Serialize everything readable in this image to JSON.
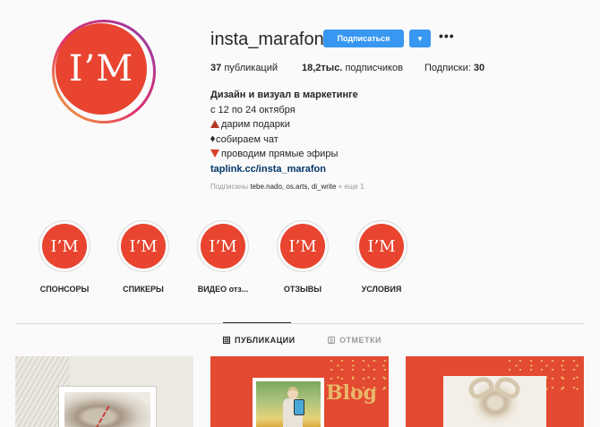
{
  "profile": {
    "avatar_text": "I’M",
    "username": "insta_marafon",
    "follow_label": "Подписаться",
    "dropdown_icon": "▼",
    "more_icon": "•••",
    "stats": {
      "posts_count": "37",
      "posts_label": "публикаций",
      "followers_count": "18,2тыс.",
      "followers_label": "подписчиков",
      "following_label": "Подписки:",
      "following_count": "30"
    },
    "bio": {
      "title": "Дизайн и визуал в маркетинге",
      "line1": "с 12 по 24 октября",
      "line2": "дарим подарки",
      "line3": "собираем чат",
      "line4": "проводим прямые эфиры",
      "link": "taplink.cc/insta_marafon"
    },
    "followed_by": {
      "prefix": "Подписаны",
      "names": "tebe.nado, os.arts, di_write",
      "suffix": "+ еще 1"
    },
    "colors": {
      "brand_red": "#e8442f",
      "button_blue": "#3897f0",
      "link_blue": "#003569"
    }
  },
  "highlights": [
    {
      "label": "СПОНСОРЫ",
      "text": "I’M"
    },
    {
      "label": "СПИКЕРЫ",
      "text": "I’M"
    },
    {
      "label": "ВИДЕО отз...",
      "text": "I’M"
    },
    {
      "label": "ОТЗЫВЫ",
      "text": "I’M"
    },
    {
      "label": "УСЛОВИЯ",
      "text": "I’M"
    }
  ],
  "tabs": [
    {
      "label": "ПУБЛИКАЦИИ",
      "icon": "grid-icon",
      "active": true
    },
    {
      "label": "ОТМЕТКИ",
      "icon": "tag-icon",
      "active": false
    }
  ],
  "posts": [
    {
      "icon": "gift-photo"
    },
    {
      "text": "Blog",
      "icon": "person-photo"
    },
    {
      "icon": "bow-photo"
    }
  ]
}
